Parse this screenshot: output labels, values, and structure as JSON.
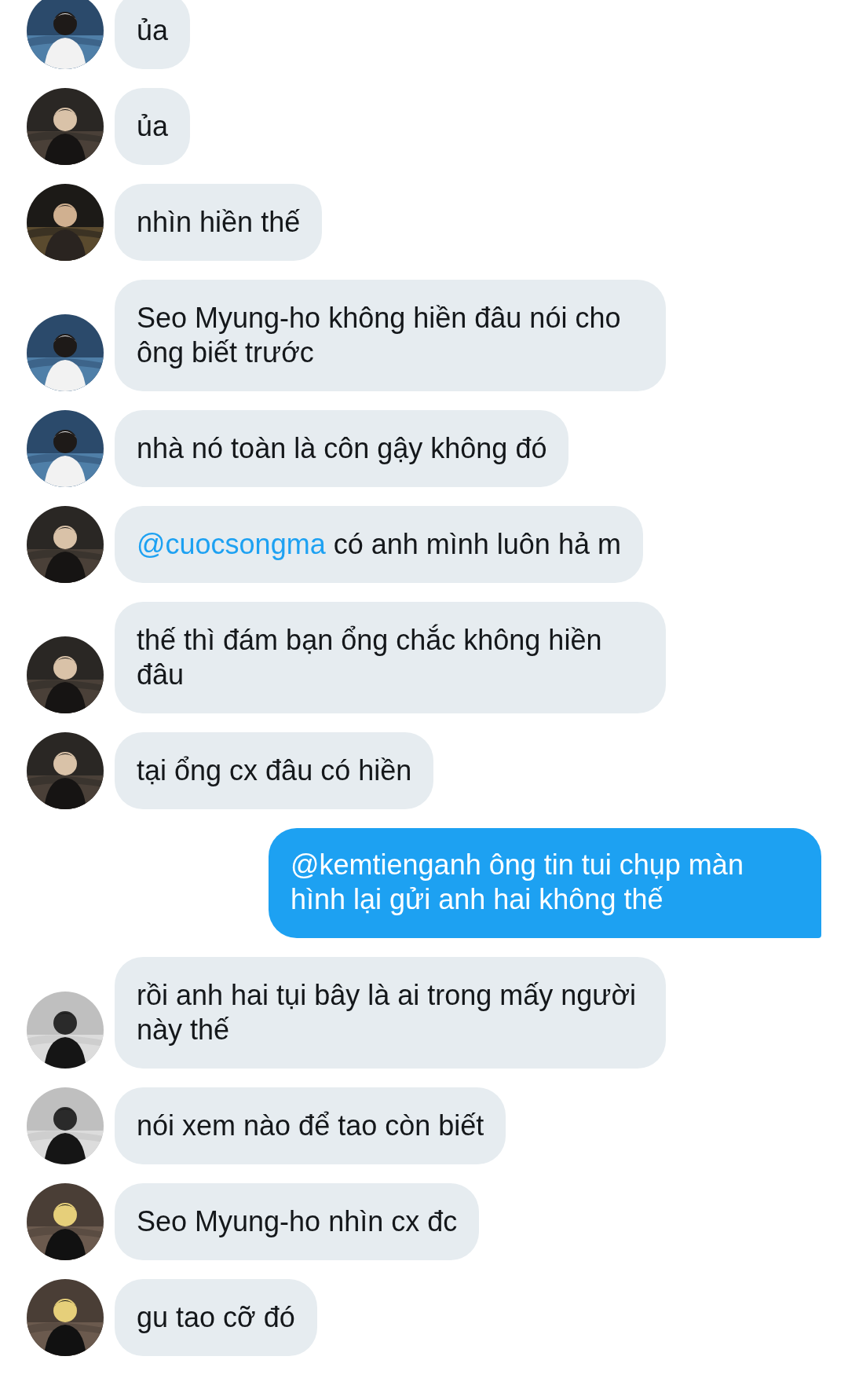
{
  "messages": [
    {
      "kind": "received",
      "text": "ủa"
    },
    {
      "kind": "received",
      "text": "ủa"
    },
    {
      "kind": "received",
      "text": "nhìn hiền thế"
    },
    {
      "kind": "received",
      "text": "Seo Myung-ho không hiền đâu nói cho ông biết trước"
    },
    {
      "kind": "received",
      "text": "nhà nó toàn là côn gậy không đó"
    },
    {
      "kind": "received",
      "mention": "@cuocsongma",
      "text": "có anh mình luôn hả m"
    },
    {
      "kind": "received",
      "text": "thế thì đám bạn ổng chắc không hiền đâu"
    },
    {
      "kind": "received",
      "text": "tại ổng cx đâu có hiền"
    },
    {
      "kind": "sent",
      "text": "@kemtienganh ông tin tui chụp màn hình lại gửi anh hai không thế"
    },
    {
      "kind": "received",
      "text": "rồi anh hai tụi bây là ai trong mấy người này thế"
    },
    {
      "kind": "received",
      "text": "nói xem nào để tao còn biết"
    },
    {
      "kind": "received",
      "text": "Seo Myung-ho nhìn cx đc"
    },
    {
      "kind": "received",
      "text": "gu tao cỡ đó"
    }
  ]
}
